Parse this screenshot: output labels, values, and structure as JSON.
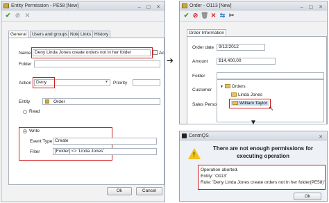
{
  "left_window": {
    "title": "Entity Permission - PE58 [New]",
    "tabs": [
      "General",
      "Users and groups",
      "Note",
      "Links",
      "History"
    ],
    "name_label": "Name",
    "name_value": "Deny Linda Jones create orders not in her folder",
    "active_label": "Ac",
    "folder_label": "Folder",
    "action_label": "Action",
    "action_value": "Deny",
    "priority_label": "Priority",
    "entity_label": "Entity",
    "entity_value": "Order",
    "read_label": "Read",
    "write_label": "Write",
    "event_type_label": "Event Type",
    "event_type_value": "Create",
    "filter_label": "Filter",
    "filter_value": "[Folder] <> 'Linda Jones'",
    "ok_label": "Ok",
    "cancel_label": "Cancel"
  },
  "right_window": {
    "title": "Order - O113 [New]",
    "tab": "Order Information",
    "order_date_label": "Order date",
    "order_date_value": "9/12/2012",
    "amount_label": "Amount",
    "amount_value": "$14,400.00",
    "folder_label": "Folder",
    "customer_label": "Customer",
    "sales_person_label": "Sales Person",
    "tree": [
      "Orders",
      "Linda Jones",
      "William Taylor"
    ]
  },
  "dialog": {
    "title": "CentriQS",
    "heading": "There are not enough permissions for executing operation",
    "msg_line1": "Operation aborted.",
    "msg_line2": "Entity: 'O113'",
    "msg_line3": "Rule: 'Deny Linda Jones create orders not in her folder(PE58)'",
    "ok_label": "Ok"
  }
}
